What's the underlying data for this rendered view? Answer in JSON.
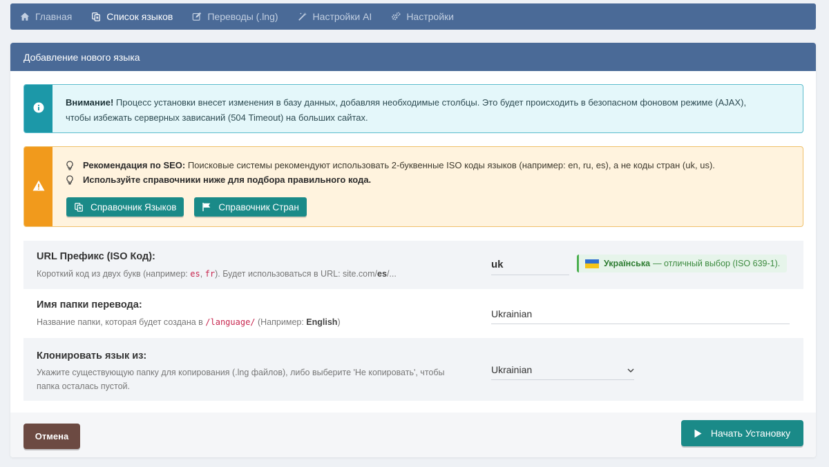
{
  "nav": {
    "items": [
      {
        "label": "Главная",
        "icon": "home-icon"
      },
      {
        "label": "Список языков",
        "icon": "language-icon"
      },
      {
        "label": "Переводы (.lng)",
        "icon": "edit-icon"
      },
      {
        "label": "Настройки AI",
        "icon": "magic-wand-icon"
      },
      {
        "label": "Настройки",
        "icon": "gears-icon"
      }
    ],
    "active_index": 1
  },
  "card": {
    "title": "Добавление нового языка"
  },
  "info_alert": {
    "icon": "info-circle-icon",
    "strong": "Внимание!",
    "text": " Процесс установки внесет изменения в базу данных, добавляя необходимые столбцы. Это будет происходить в безопасном фоновом режиме (AJAX),",
    "text2": "чтобы избежать серверных зависаний (504 Timeout) на больших сайтах."
  },
  "warn_alert": {
    "icon": "warning-triangle-icon",
    "tip1_strong": "Рекомендация по SEO:",
    "tip1_text": " Поисковые системы рекомендуют использовать 2-буквенные ISO коды языков (например: en, ru, es), а не коды стран (uk, us).",
    "tip2_strong": "Используйте справочники ниже для подбора правильного кода.",
    "btn_languages": "Справочник Языков",
    "btn_countries": "Справочник Стран"
  },
  "form": {
    "prefix": {
      "label": "URL Префикс (ISO Код):",
      "hint_a": "Короткий код из двух букв (например: ",
      "code1": "es",
      "hint_sep": ", ",
      "code2": "fr",
      "hint_b": "). Будет использоваться в URL: site.com/",
      "hint_bold": "es",
      "hint_c": "/...",
      "value": "uk",
      "badge_lang": "Українська",
      "badge_text": "— отличный выбор (ISO 639-1)."
    },
    "folder": {
      "label": "Имя папки перевода:",
      "hint_a": "Название папки, которая будет создана в ",
      "code": "/language/",
      "hint_b": " (Например: ",
      "hint_bold": "English",
      "hint_c": ")",
      "value": "Ukrainian"
    },
    "clone": {
      "label": "Клонировать язык из:",
      "hint_line1": "Укажите существующую папку для копирования (.lng файлов), либо выберите 'Не копировать', чтобы",
      "hint_line2": "папка осталась пустой.",
      "selected": "Ukrainian"
    }
  },
  "footer": {
    "cancel_label": "Отмена",
    "start_label": "Начать Установку"
  },
  "colors": {
    "header": "#4a6a97",
    "teal": "#1a8a88",
    "info_accent": "#1c98a8",
    "warn_accent": "#f19a1c",
    "cancel": "#6c4a42"
  }
}
